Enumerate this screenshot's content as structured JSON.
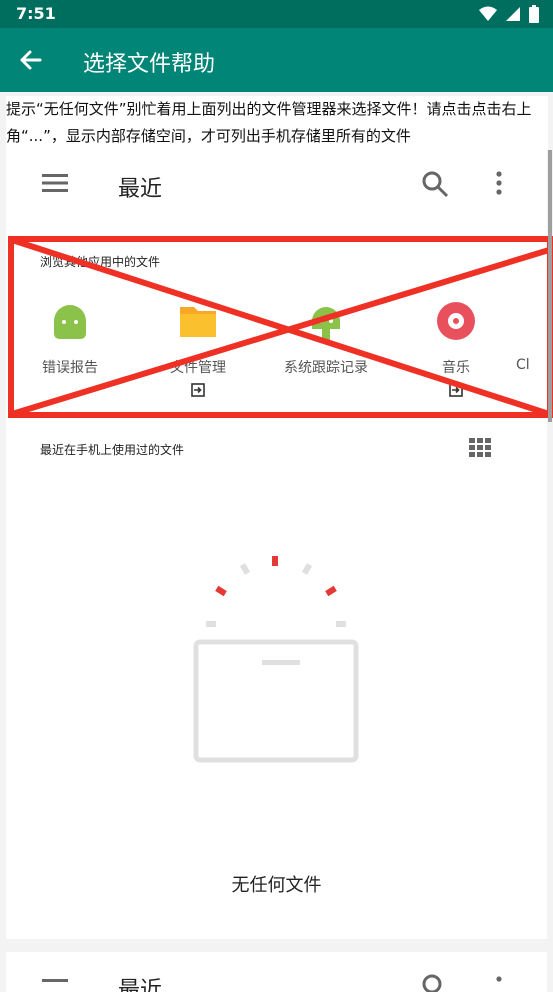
{
  "status_bar": {
    "time": "7:51",
    "icons": [
      "wifi-icon",
      "signal-icon",
      "battery-icon"
    ]
  },
  "app_bar": {
    "title": "选择文件帮助",
    "back_icon": "arrow-back-icon"
  },
  "hint": {
    "text": "提示“无任何文件”别忙着用上面列出的文件管理器来选择文件！请点击点击右上角“...”，显示内部存储空间，才可列出手机存储里所有的文件"
  },
  "screenshot": {
    "toolbar_title": "最近",
    "section_apps_title": "浏览其他应用中的文件",
    "apps": [
      {
        "label": "错误报告",
        "icon": "android-icon",
        "has_open_icon": false
      },
      {
        "label": "文件管理",
        "icon": "folder-icon",
        "has_open_icon": true
      },
      {
        "label": "系统跟踪记录",
        "icon": "android-icon",
        "has_open_icon": false
      },
      {
        "label": "音乐",
        "icon": "music-icon",
        "has_open_icon": true
      },
      {
        "label": "Cl",
        "icon": "",
        "has_open_icon": false
      }
    ],
    "section_recent_title": "最近在手机上使用过的文件",
    "empty_text": "无任何文件",
    "second_toolbar_title": "最近"
  },
  "colors": {
    "status_bar": "#006e5e",
    "app_bar": "#008577",
    "cross_out": "#ee3124"
  }
}
